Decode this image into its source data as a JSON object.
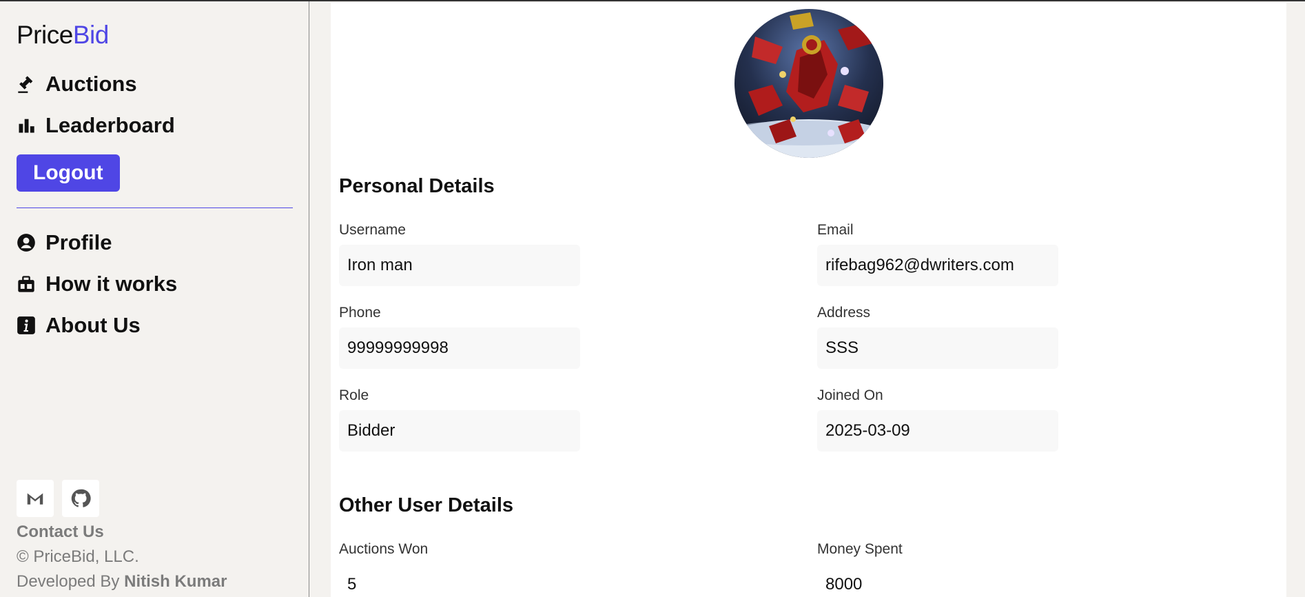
{
  "brand": {
    "part1": "Price",
    "part2": "Bid"
  },
  "nav": {
    "auctions": "Auctions",
    "leaderboard": "Leaderboard",
    "logout": "Logout",
    "profile": "Profile",
    "how_it_works": "How it works",
    "about_us": "About Us"
  },
  "footer": {
    "contact": "Contact Us",
    "copyright": "© PriceBid, LLC.",
    "developed_by": "Developed By",
    "developer": "Nitish Kumar"
  },
  "personal": {
    "title": "Personal Details",
    "username_label": "Username",
    "username": "Iron man",
    "email_label": "Email",
    "email": "rifebag962@dwriters.com",
    "phone_label": "Phone",
    "phone": "99999999998",
    "address_label": "Address",
    "address": "SSS",
    "role_label": "Role",
    "role": "Bidder",
    "joined_label": "Joined On",
    "joined": "2025-03-09"
  },
  "other": {
    "title": "Other User Details",
    "won_label": "Auctions Won",
    "won": "5",
    "spent_label": "Money Spent",
    "spent": "8000"
  },
  "colors": {
    "accent": "#4f46e5",
    "sidebar_bg": "#f4f2ef"
  }
}
